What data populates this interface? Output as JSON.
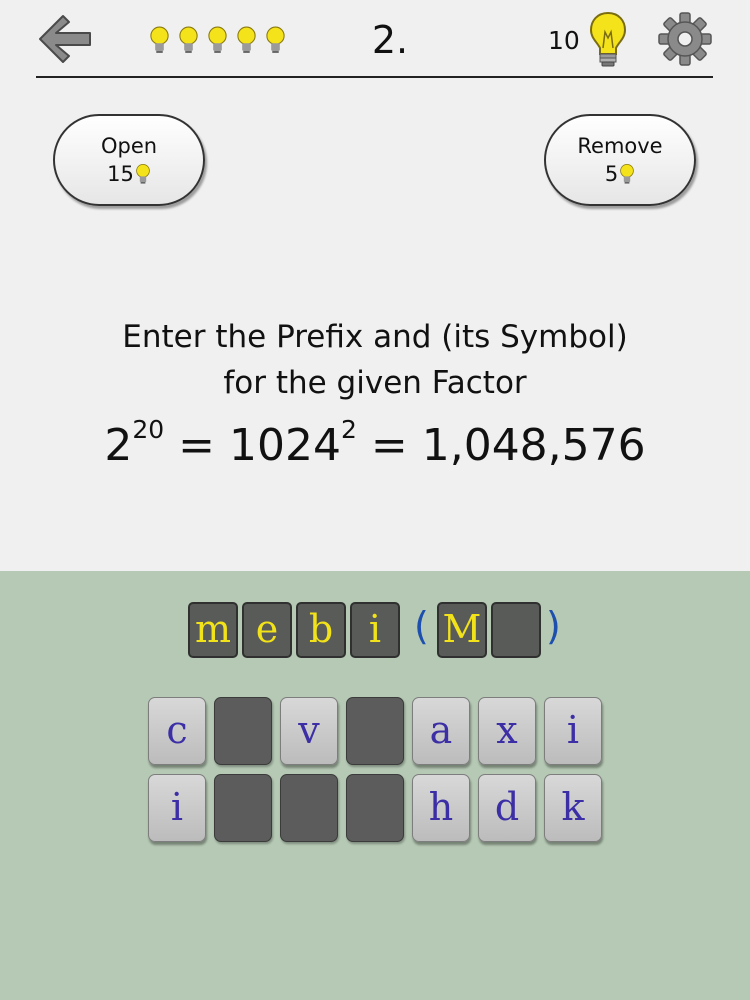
{
  "header": {
    "level": "2.",
    "hint_count": "10",
    "bulb_color": "#f4e21a"
  },
  "actions": {
    "open": {
      "label": "Open",
      "cost": "15"
    },
    "remove": {
      "label": "Remove",
      "cost": "5"
    }
  },
  "question": {
    "line1": "Enter the Prefix and (its Symbol)",
    "line2": "for the given Factor",
    "eq_base": "2",
    "eq_exp1": "20",
    "eq_mid": " = 1024",
    "eq_exp2": "2",
    "eq_end": " = 1,048,576"
  },
  "answer": {
    "prefix": [
      "m",
      "e",
      "b",
      "i"
    ],
    "open_paren": "(",
    "symbol": [
      "M",
      ""
    ],
    "close_paren": ")"
  },
  "keyboard": {
    "row1": [
      "c",
      "",
      "v",
      "",
      "a",
      "x",
      "i"
    ],
    "row2": [
      "i",
      "",
      "",
      "",
      "h",
      "d",
      "k"
    ]
  },
  "colors": {
    "bottom_panel": "#b5c9b4",
    "answer_letter": "#f2e21a",
    "key_letter": "#3c2fa6",
    "paren": "#1d4fae"
  }
}
